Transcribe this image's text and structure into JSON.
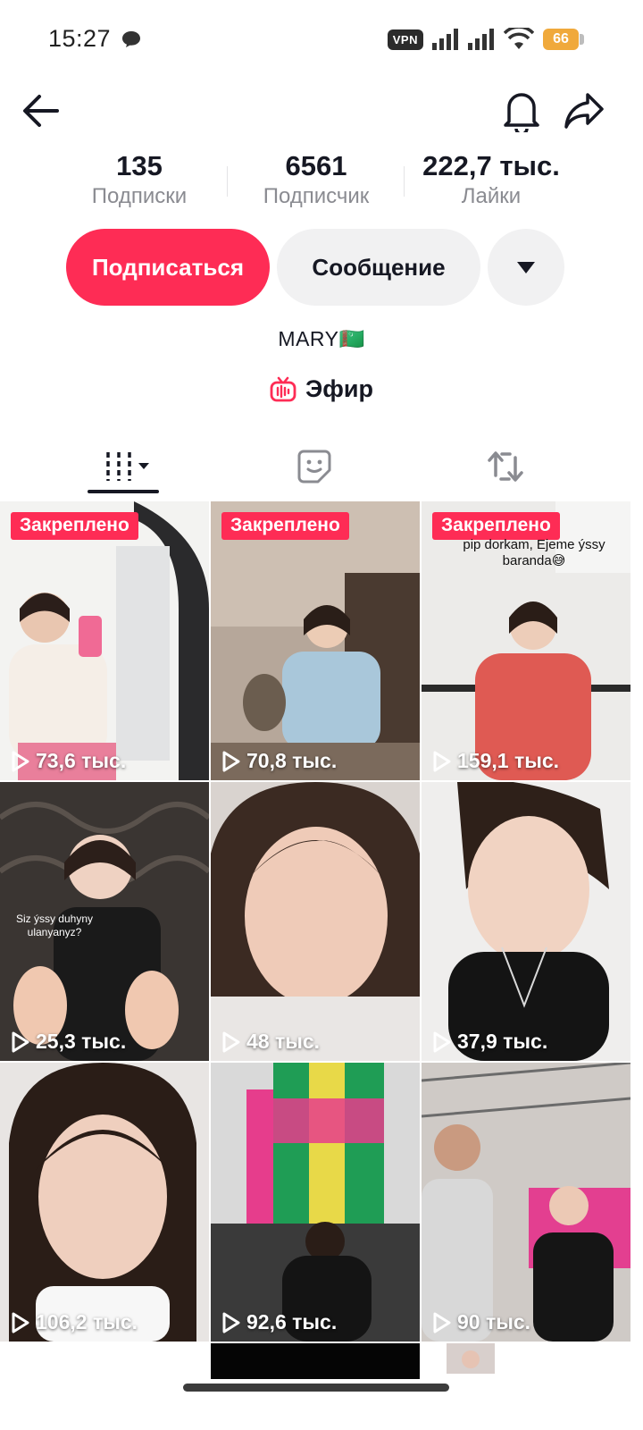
{
  "status_bar": {
    "time": "15:27",
    "vpn": "VPN",
    "battery": "66"
  },
  "header": {
    "back": "back-arrow-icon",
    "bell": "bell-icon",
    "share": "share-icon"
  },
  "stats": [
    {
      "value": "135",
      "label": "Подписки"
    },
    {
      "value": "6561",
      "label": "Подписчик"
    },
    {
      "value": "222,7 тыс.",
      "label": "Лайки"
    }
  ],
  "actions": {
    "follow": "Подписаться",
    "message": "Сообщение"
  },
  "bio": {
    "name": "MARY🇹🇲"
  },
  "live": {
    "label": "Эфир"
  },
  "tabs": [
    "videos-grid-icon",
    "favorites-sticker-icon",
    "reposts-icon"
  ],
  "colors": {
    "accent": "#fe2c55",
    "text": "#161823",
    "muted": "#8a8b91",
    "chip": "#f1f1f2"
  },
  "videos": [
    {
      "pinned": "Закреплено",
      "views": "73,6 тыс."
    },
    {
      "pinned": "Закреплено",
      "views": "70,8 тыс."
    },
    {
      "pinned": "Закреплено",
      "views": "159,1 тыс.",
      "caption": "pip dorkam, Ejeme ýssy baranda😅"
    },
    {
      "views": "25,3 тыс.",
      "caption": "Siz ýssy duhyny ulanyanyz?"
    },
    {
      "views": "48 тыс."
    },
    {
      "views": "37,9 тыс."
    },
    {
      "views": "106,2 тыс."
    },
    {
      "views": "92,6 тыс."
    },
    {
      "views": "90 тыс."
    }
  ]
}
